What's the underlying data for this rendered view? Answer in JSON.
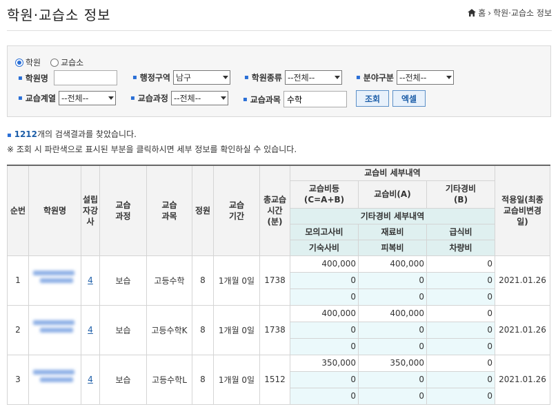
{
  "header": {
    "title": "학원·교습소 정보",
    "breadcrumb": [
      "홈",
      "학원·교습소 정보"
    ]
  },
  "search": {
    "type_options": [
      "학원",
      "교습소"
    ],
    "selected_type": "학원",
    "academy_name": {
      "label": "학원명",
      "value": ""
    },
    "district": {
      "label": "행정구역",
      "value": "남구"
    },
    "academy_kind": {
      "label": "학원종류",
      "value": "--전체--"
    },
    "field_kind": {
      "label": "분야구분",
      "value": "--전체--"
    },
    "subject_group": {
      "label": "교습계열",
      "value": "--전체--"
    },
    "course": {
      "label": "교습과정",
      "value": "--전체--"
    },
    "subject": {
      "label": "교습과목",
      "value": "수학"
    },
    "search_button": "조회",
    "excel_button": "엑셀"
  },
  "results": {
    "count": "1212",
    "count_suffix": "개의 검색결과를 찾았습니다.",
    "note": "※ 조회 시 파란색으로 표시된 부분을 클릭하시면 세부 정보를 확인하실 수 있습니다."
  },
  "table": {
    "headers": {
      "no": "순번",
      "name": "학원명",
      "founder_lecturer": "설립자강사",
      "course": "교습과정",
      "subject": "교습과목",
      "capacity": "정원",
      "period": "교습기간",
      "total_hours": "총교습시간(분)",
      "fee_detail": "교습비 세부내역",
      "fee_total": "교습비등(C=A+B)",
      "fee_a": "교습비(A)",
      "fee_b": "기타경비(B)",
      "etc_detail": "기타경비 세부내역",
      "mock_exam": "모의고사비",
      "material": "재료비",
      "meal": "급식비",
      "dorm": "기숙사비",
      "uniform": "피복비",
      "vehicle": "차량비",
      "apply_date": "적용일(최종교습비변경일)"
    },
    "rows": [
      {
        "no": "1",
        "teachers": "4",
        "course": "보습",
        "subject": "고등수학",
        "capacity": "8",
        "period": "1개월 0일",
        "hours": "1738",
        "fee_total": "400,000",
        "fee_a": "400,000",
        "fee_b": "0",
        "mock": "0",
        "material": "0",
        "meal": "0",
        "dorm": "0",
        "uniform": "0",
        "vehicle": "0",
        "date": "2021.01.26"
      },
      {
        "no": "2",
        "teachers": "4",
        "course": "보습",
        "subject": "고등수학K",
        "capacity": "8",
        "period": "1개월 0일",
        "hours": "1738",
        "fee_total": "400,000",
        "fee_a": "400,000",
        "fee_b": "0",
        "mock": "0",
        "material": "0",
        "meal": "0",
        "dorm": "0",
        "uniform": "0",
        "vehicle": "0",
        "date": "2021.01.26"
      },
      {
        "no": "3",
        "teachers": "4",
        "course": "보습",
        "subject": "고등수학L",
        "capacity": "8",
        "period": "1개월 0일",
        "hours": "1512",
        "fee_total": "350,000",
        "fee_a": "350,000",
        "fee_b": "0",
        "mock": "0",
        "material": "0",
        "meal": "0",
        "dorm": "0",
        "uniform": "0",
        "vehicle": "0",
        "date": "2021.01.26"
      }
    ]
  },
  "colors": {
    "accent": "#1d5ea8",
    "sub_header": "#dff0f0",
    "cyan_cell": "#ebf9fb"
  }
}
